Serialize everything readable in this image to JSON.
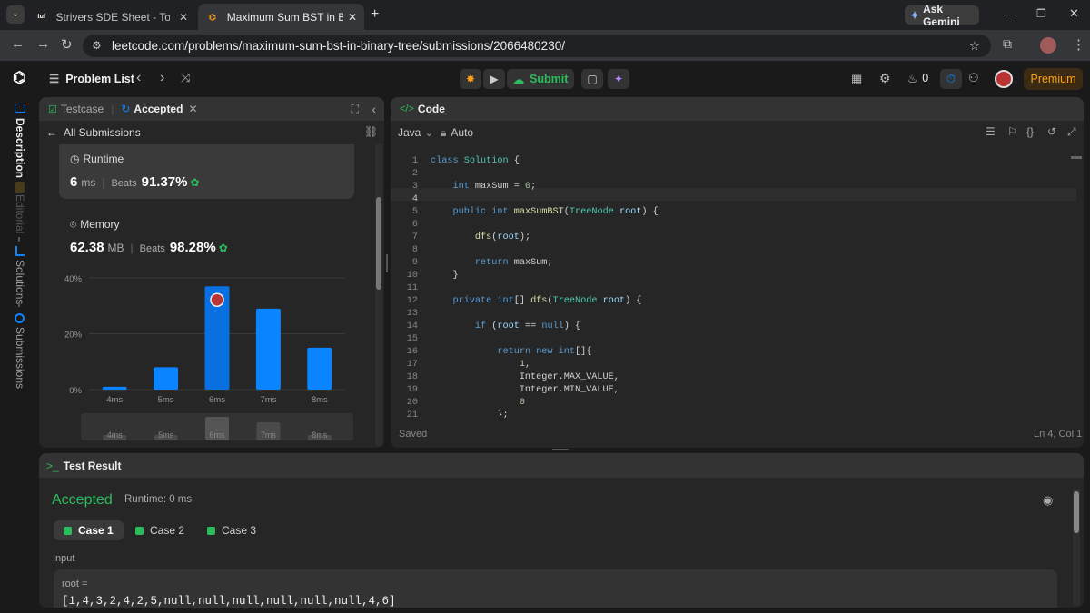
{
  "browser": {
    "tabs": [
      {
        "title": "Strivers SDE Sheet - Top Coding",
        "favicon": "tuf-icon"
      },
      {
        "title": "Maximum Sum BST in Binary Tre",
        "favicon": "leetcode-icon"
      }
    ],
    "ask_gemini": "Ask Gemini",
    "url": "leetcode.com/problems/maximum-sum-bst-in-binary-tree/submissions/2066480230/"
  },
  "header": {
    "problem_list": "Problem List",
    "submit": "Submit",
    "streak": "0",
    "premium": "Premium"
  },
  "side_tabs": [
    "Description",
    "Editorial",
    "Solutions",
    "Submissions"
  ],
  "left_panel": {
    "tab_testcase": "Testcase",
    "tab_accepted": "Accepted",
    "all_submissions": "All Submissions",
    "runtime": {
      "label": "Runtime",
      "value": "6",
      "unit": "ms",
      "beats_label": "Beats",
      "beats": "91.37%"
    },
    "memory": {
      "label": "Memory",
      "value": "62.38",
      "unit": "MB",
      "beats_label": "Beats",
      "beats": "98.28%"
    }
  },
  "chart_data": {
    "type": "bar",
    "categories": [
      "4ms",
      "5ms",
      "6ms",
      "7ms",
      "8ms"
    ],
    "values": [
      1,
      8,
      37,
      29,
      15
    ],
    "ylabel": "",
    "yticks": [
      "0%",
      "20%",
      "40%"
    ],
    "ylim": [
      0,
      40
    ],
    "highlight": "6ms",
    "bar_color": "#0a84ff",
    "minimap_labels": [
      "4ms",
      "5ms",
      "6ms",
      "7ms",
      "8ms"
    ]
  },
  "code_panel": {
    "title": "Code",
    "language": "Java",
    "mode": "Auto",
    "status": "Saved",
    "cursor": "Ln 4, Col 1",
    "lines": [
      "class Solution {",
      "",
      "    int maxSum = 0;",
      "",
      "    public int maxSumBST(TreeNode root) {",
      "",
      "        dfs(root);",
      "",
      "        return maxSum;",
      "    }",
      "",
      "    private int[] dfs(TreeNode root) {",
      "",
      "        if (root == null) {",
      "",
      "            return new int[]{",
      "                1,",
      "                Integer.MAX_VALUE,",
      "                Integer.MIN_VALUE,",
      "                0",
      "            };"
    ]
  },
  "test_result": {
    "title": "Test Result",
    "status": "Accepted",
    "runtime": "Runtime: 0 ms",
    "cases": [
      "Case 1",
      "Case 2",
      "Case 3"
    ],
    "input_label": "Input",
    "var_name": "root =",
    "var_value": "[1,4,3,2,4,2,5,null,null,null,null,null,null,4,6]"
  }
}
